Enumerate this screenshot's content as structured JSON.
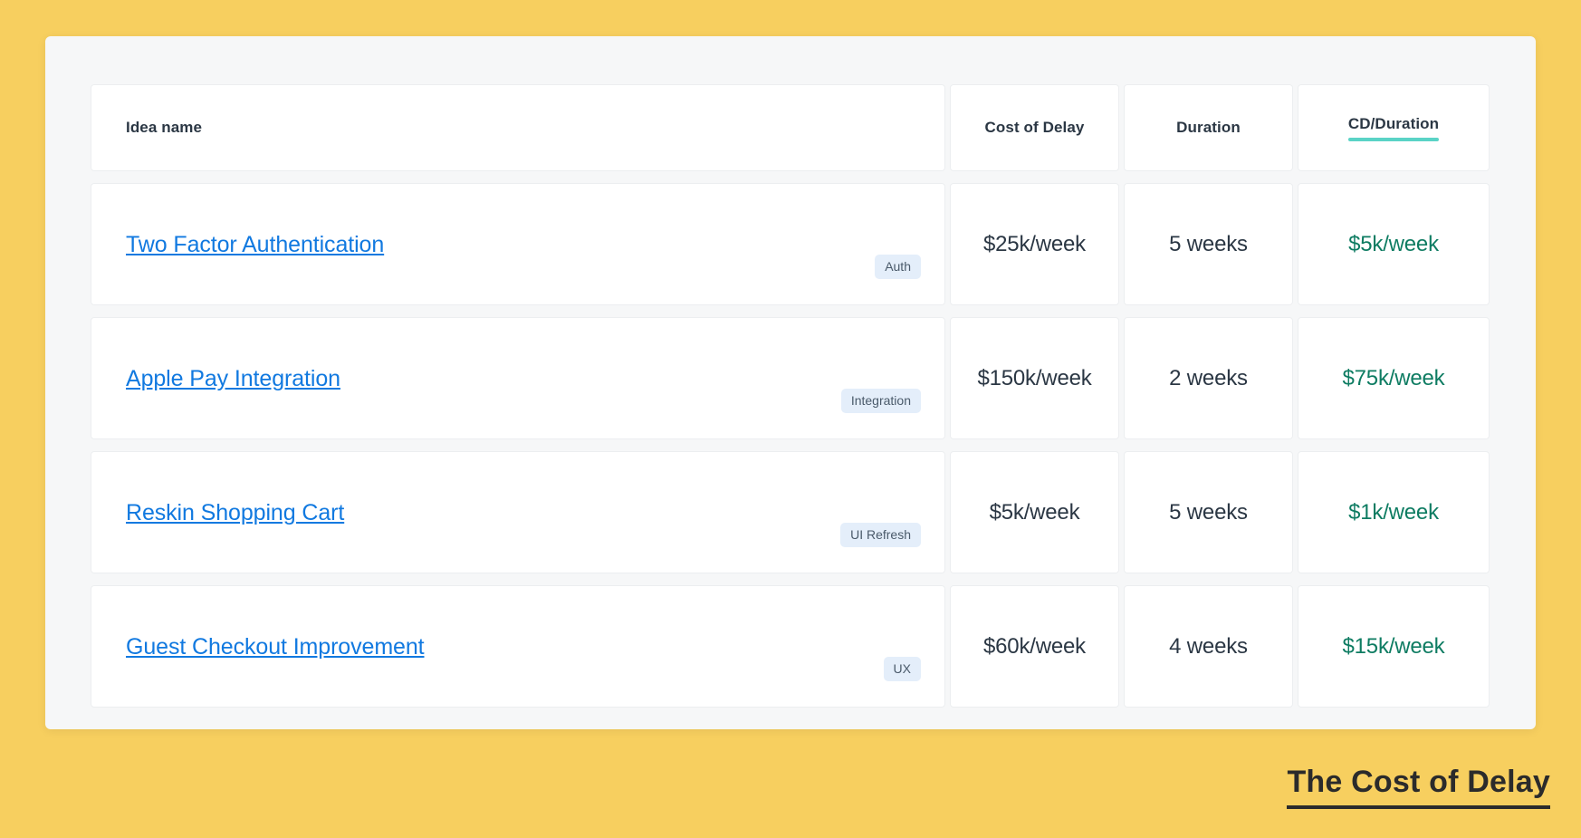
{
  "theme": {
    "background": "#f7cf5f",
    "panel_background": "#f6f7f8",
    "card_background": "#ffffff",
    "link_color": "#1179e0",
    "value_color": "#2b3744",
    "ratio_color": "#0e7c62",
    "sort_underline_color": "#5ad3c6",
    "tag_background": "#e4eefa",
    "tag_text_color": "#4a5a6a"
  },
  "table": {
    "columns": [
      {
        "key": "name",
        "label": "Idea name",
        "sorted": false
      },
      {
        "key": "cod",
        "label": "Cost of Delay",
        "sorted": false
      },
      {
        "key": "duration",
        "label": "Duration",
        "sorted": false
      },
      {
        "key": "ratio",
        "label": "CD/Duration",
        "sorted": true
      }
    ],
    "rows": [
      {
        "name": "Two Factor Authentication",
        "tag": "Auth",
        "cod": "$25k/week",
        "duration": "5 weeks",
        "ratio": "$5k/week"
      },
      {
        "name": "Apple Pay Integration",
        "tag": "Integration",
        "cod": "$150k/week",
        "duration": "2 weeks",
        "ratio": "$75k/week"
      },
      {
        "name": "Reskin Shopping Cart",
        "tag": "UI Refresh",
        "cod": "$5k/week",
        "duration": "5 weeks",
        "ratio": "$1k/week"
      },
      {
        "name": "Guest Checkout Improvement",
        "tag": "UX",
        "cod": "$60k/week",
        "duration": "4 weeks",
        "ratio": "$15k/week"
      }
    ]
  },
  "caption": {
    "text": "The Cost of Delay"
  }
}
